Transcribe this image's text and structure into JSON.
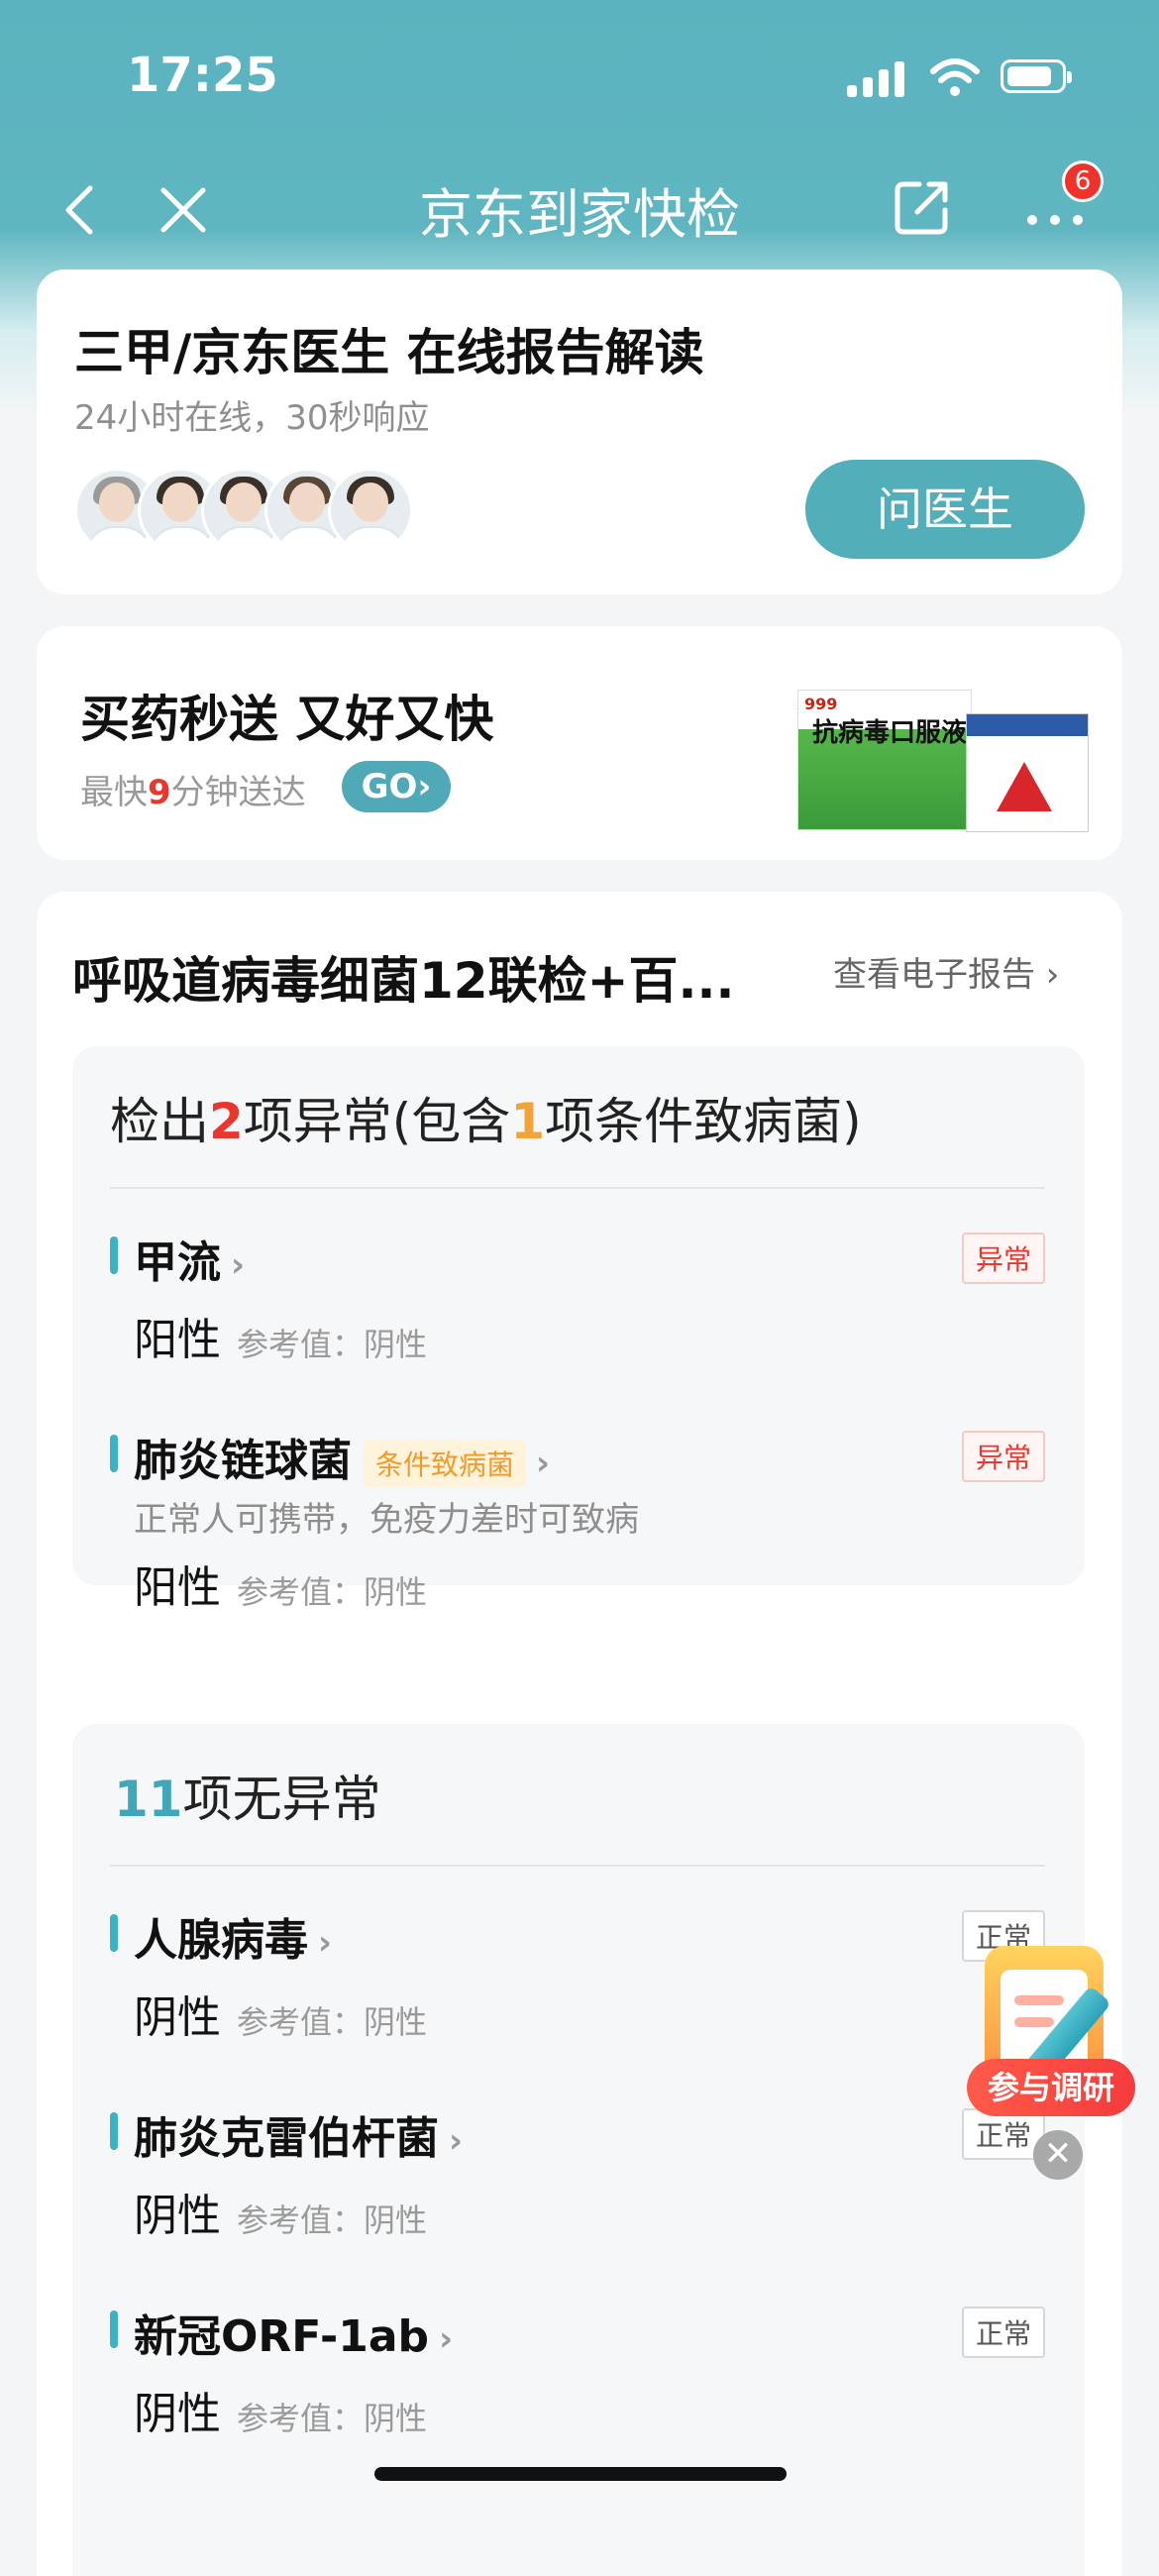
{
  "status": {
    "time": "17:25"
  },
  "nav": {
    "title": "京东到家快检",
    "badge_count": "6"
  },
  "doctor_card": {
    "title": "三甲/京东医生 在线报告解读",
    "subtitle": "24小时在线，30秒响应",
    "button": "问医生"
  },
  "drug_card": {
    "title": "买药秒送 又好又快",
    "subtitle_prefix": "最快",
    "subtitle_num": "9",
    "subtitle_suffix": "分钟送达",
    "go": "GO›",
    "pack_brand": "999",
    "pack_name": "抗病毒口服液"
  },
  "report": {
    "title": "呼吸道病毒细菌12联检+百...",
    "view_link": "查看电子报告 ›",
    "abnormal": {
      "s1": "检出",
      "count": "2",
      "s2": "项异常(包含",
      "cond_count": "1",
      "s3": "项条件致病菌)",
      "items": [
        {
          "name": "甲流",
          "tag": "异常",
          "result": "阳性",
          "ref": "参考值：阴性"
        },
        {
          "name": "肺炎链球菌",
          "cond_tag": "条件致病菌",
          "tag": "异常",
          "desc": "正常人可携带，免疫力差时可致病",
          "result": "阳性",
          "ref": "参考值：阴性"
        }
      ]
    },
    "normal": {
      "count": "11",
      "label": "项无异常",
      "items": [
        {
          "name": "人腺病毒",
          "tag": "正常",
          "result": "阴性",
          "ref": "参考值：阴性"
        },
        {
          "name": "肺炎克雷伯杆菌",
          "tag": "正常",
          "result": "阴性",
          "ref": "参考值：阴性"
        },
        {
          "name": "新冠ORF-1ab",
          "tag": "正常",
          "result": "阴性",
          "ref": "参考值：阴性"
        }
      ]
    }
  },
  "survey": {
    "label": "参与调研",
    "close": "✕"
  }
}
